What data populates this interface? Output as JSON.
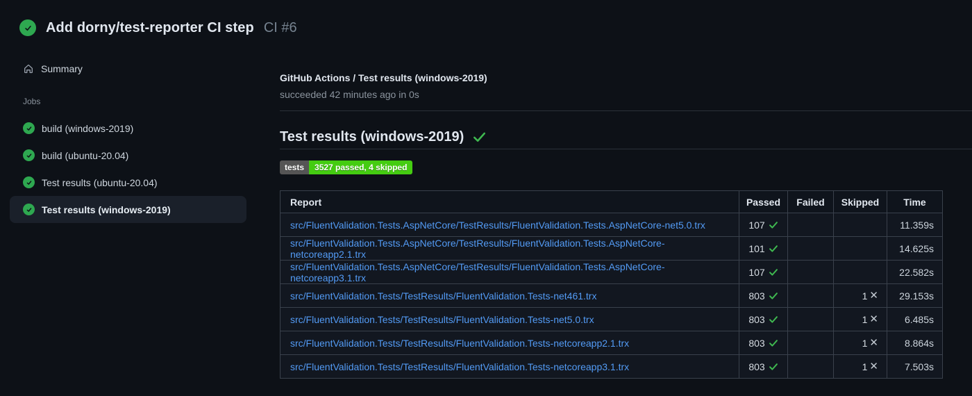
{
  "header": {
    "title": "Add dorny/test-reporter CI step",
    "run_number": "CI #6"
  },
  "sidebar": {
    "summary_label": "Summary",
    "jobs_label": "Jobs",
    "jobs": [
      {
        "label": "build (windows-2019)",
        "selected": false
      },
      {
        "label": "build (ubuntu-20.04)",
        "selected": false
      },
      {
        "label": "Test results (ubuntu-20.04)",
        "selected": false
      },
      {
        "label": "Test results (windows-2019)",
        "selected": true
      }
    ]
  },
  "main": {
    "job_title": "GitHub Actions / Test results (windows-2019)",
    "job_status": "succeeded 42 minutes ago in 0s",
    "section_title": "Test results (windows-2019)",
    "badge": {
      "label": "tests",
      "value": "3527 passed, 4 skipped"
    },
    "table": {
      "columns": [
        "Report",
        "Passed",
        "Failed",
        "Skipped",
        "Time"
      ],
      "rows": [
        {
          "report": "src/FluentValidation.Tests.AspNetCore/TestResults/FluentValidation.Tests.AspNetCore-net5.0.trx",
          "passed": "107",
          "failed": "",
          "skipped": "",
          "time": "11.359s"
        },
        {
          "report": "src/FluentValidation.Tests.AspNetCore/TestResults/FluentValidation.Tests.AspNetCore-netcoreapp2.1.trx",
          "passed": "101",
          "failed": "",
          "skipped": "",
          "time": "14.625s"
        },
        {
          "report": "src/FluentValidation.Tests.AspNetCore/TestResults/FluentValidation.Tests.AspNetCore-netcoreapp3.1.trx",
          "passed": "107",
          "failed": "",
          "skipped": "",
          "time": "22.582s"
        },
        {
          "report": "src/FluentValidation.Tests/TestResults/FluentValidation.Tests-net461.trx",
          "passed": "803",
          "failed": "",
          "skipped": "1",
          "time": "29.153s"
        },
        {
          "report": "src/FluentValidation.Tests/TestResults/FluentValidation.Tests-net5.0.trx",
          "passed": "803",
          "failed": "",
          "skipped": "1",
          "time": "6.485s"
        },
        {
          "report": "src/FluentValidation.Tests/TestResults/FluentValidation.Tests-netcoreapp2.1.trx",
          "passed": "803",
          "failed": "",
          "skipped": "1",
          "time": "8.864s"
        },
        {
          "report": "src/FluentValidation.Tests/TestResults/FluentValidation.Tests-netcoreapp3.1.trx",
          "passed": "803",
          "failed": "",
          "skipped": "1",
          "time": "7.503s"
        }
      ]
    }
  },
  "icons": {
    "status": "check-circle",
    "summary": "home-icon",
    "heading_check": "check-icon",
    "skipped_mark": "x-icon"
  },
  "colors": {
    "page_bg": "#0d1117",
    "success_circle": "#2ea850",
    "success_check": "#3fb950",
    "link_blue": "#539bf5",
    "badge_label_bg": "#555555",
    "badge_value_bg": "#44cc11",
    "selected_item_bg": "#1a202a",
    "table_border": "#3a414c",
    "row_bg": "#121720",
    "muted_text": "#8b949e"
  }
}
